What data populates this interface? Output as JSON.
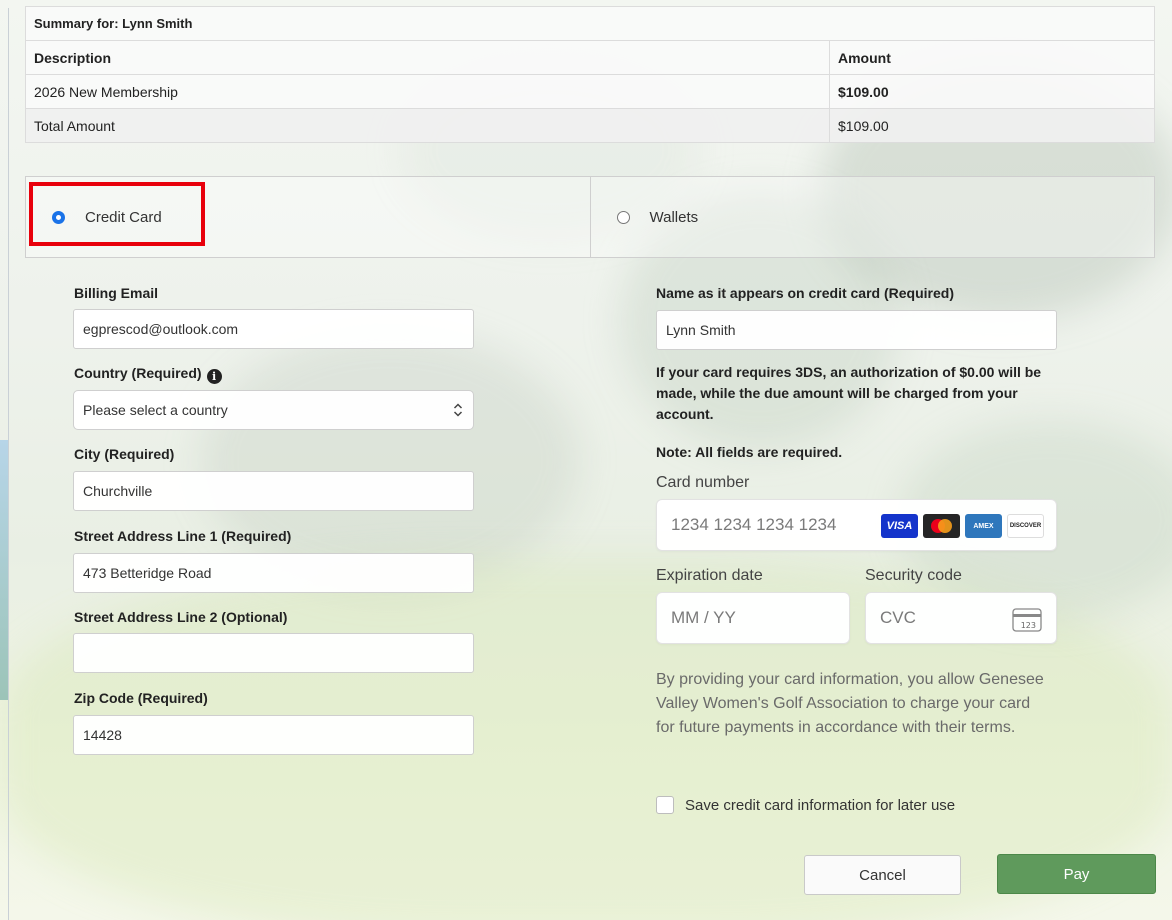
{
  "summary": {
    "title": "Summary for: Lynn Smith",
    "headers": {
      "description": "Description",
      "amount": "Amount"
    },
    "rows": [
      {
        "description": "2026 New Membership",
        "amount": "$109.00"
      }
    ],
    "total": {
      "label": "Total Amount",
      "amount": "$109.00"
    }
  },
  "payment_methods": {
    "credit_card": {
      "label": "Credit Card",
      "selected": true
    },
    "wallets": {
      "label": "Wallets",
      "selected": false
    }
  },
  "billing": {
    "email_label": "Billing Email",
    "email_value": "egprescod@outlook.com",
    "country_label": "Country (Required)",
    "country_value": "Please select a country",
    "city_label": "City (Required)",
    "city_value": "Churchville",
    "street1_label": "Street Address Line 1 (Required)",
    "street1_value": "473 Betteridge Road",
    "street2_label": "Street Address Line 2 (Optional)",
    "street2_value": "",
    "zip_label": "Zip Code (Required)",
    "zip_value": "14428"
  },
  "card": {
    "name_label": "Name as it appears on credit card (Required)",
    "name_value": "Lynn Smith",
    "notice_3ds": "If your card requires 3DS, an authorization of $0.00 will be made, while the due amount will be charged from your account.",
    "note": "Note: All fields are required.",
    "number_label": "Card number",
    "number_placeholder": "1234 1234 1234 1234",
    "brands": {
      "visa": "VISA",
      "amex": "AMEX",
      "discover": "DISCOVER"
    },
    "expiry_label": "Expiration date",
    "expiry_placeholder": "MM / YY",
    "cvc_label": "Security code",
    "cvc_placeholder": "CVC",
    "cvc_icon_text": "123",
    "consent": "By providing your card information, you allow Genesee Valley Women's Golf Association to charge your card for future payments in accordance with their terms.",
    "save_label": "Save credit card information for later use",
    "save_checked": false
  },
  "actions": {
    "cancel": "Cancel",
    "pay": "Pay"
  },
  "colors": {
    "pay_button": "#5f9a5c",
    "highlight": "#e8000b",
    "radio_selected": "#1a73e8"
  }
}
